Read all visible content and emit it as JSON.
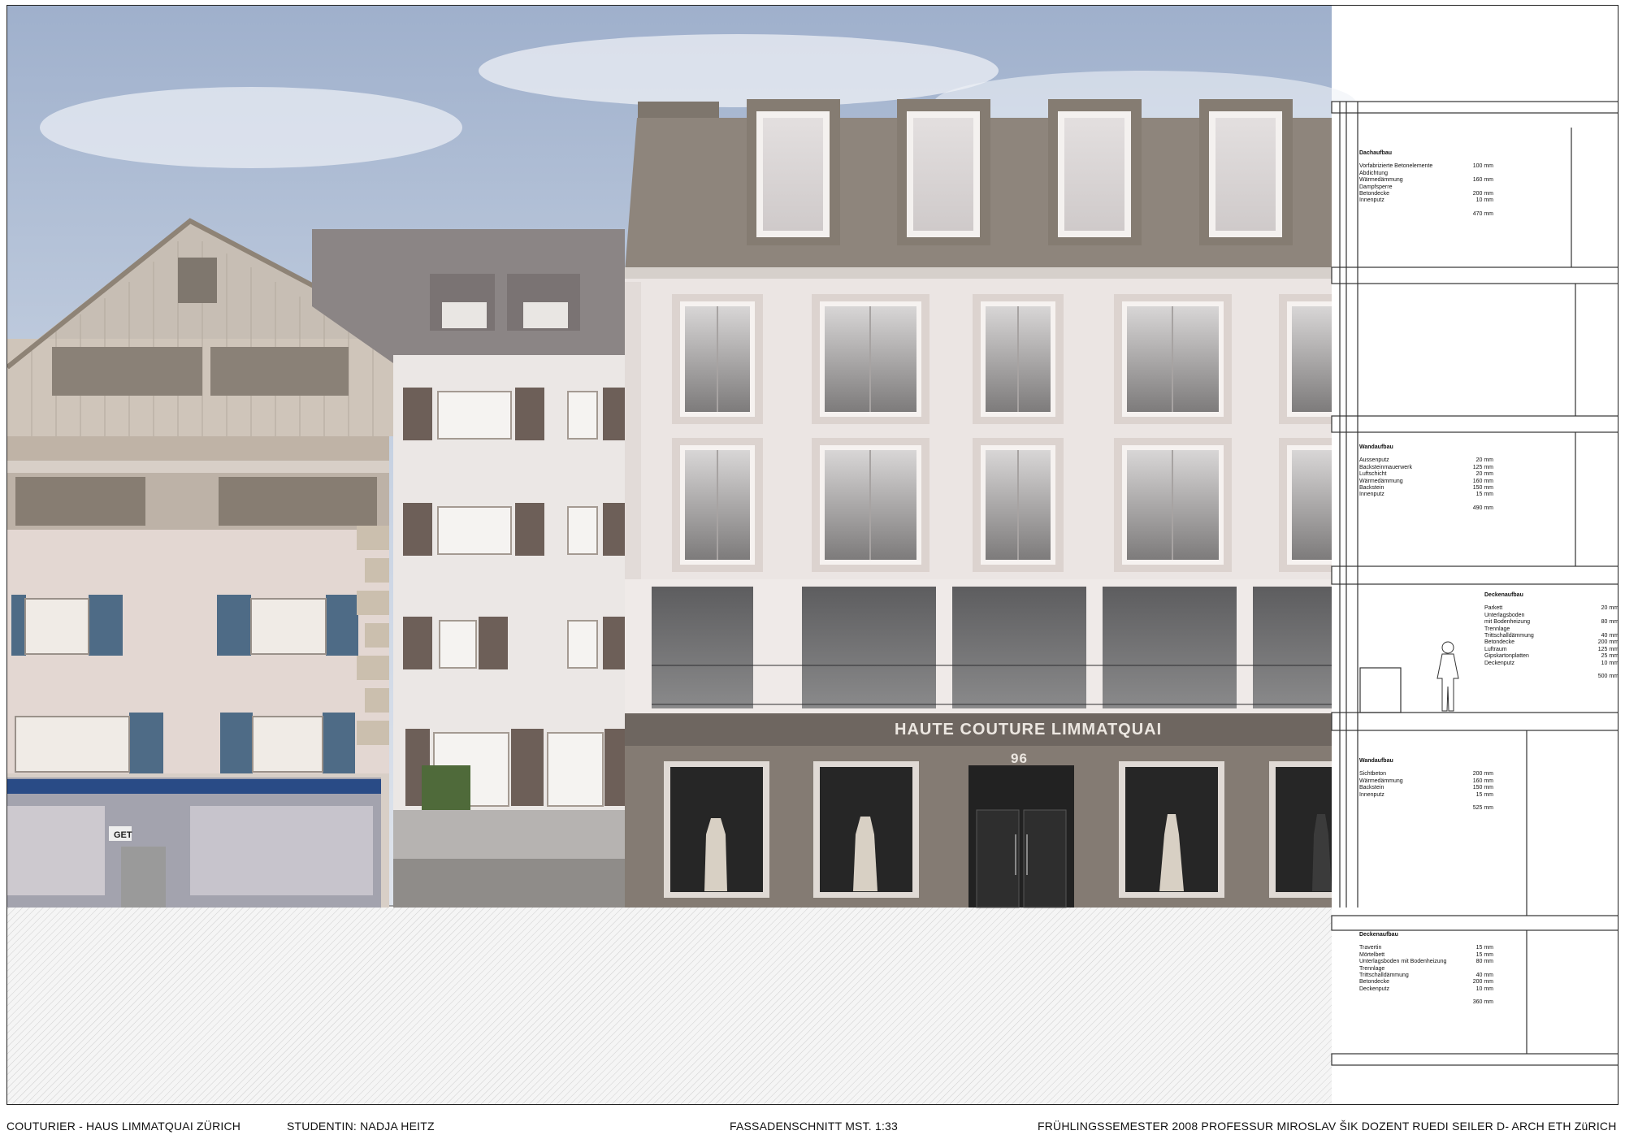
{
  "facade": {
    "sign_text": "HAUTE COUTURE LIMMATQUAI",
    "house_number": "96",
    "neighbor_shop_sign": "GET"
  },
  "footer": {
    "project": "COUTURIER - HAUS LIMMATQUAI  ZÜRICH",
    "student": "STUDENTIN: NADJA HEITZ",
    "drawing": "FASSADENSCHNITT MST. 1:33",
    "semester": "FRÜHLINGSSEMESTER 2008  PROFESSUR MIROSLAV ŠIK  DOZENT RUEDI SEILER  D- ARCH  ETH ZüRICH"
  },
  "section_specs": [
    {
      "heading": "Dachaufbau",
      "rows": [
        {
          "material": "Vorfabrizierte Betonelemente",
          "value": "100 mm"
        },
        {
          "material": "Abdichtung",
          "value": ""
        },
        {
          "material": "Wärmedämmung",
          "value": "160 mm"
        },
        {
          "material": "Dampfsperre",
          "value": ""
        },
        {
          "material": "Betondecke",
          "value": "200 mm"
        },
        {
          "material": "Innenputz",
          "value": "10 mm"
        }
      ],
      "total": "470 mm"
    },
    {
      "heading": "Wandaufbau",
      "rows": [
        {
          "material": "Aussenputz",
          "value": "20 mm"
        },
        {
          "material": "Backsteinmauerwerk",
          "value": "125 mm"
        },
        {
          "material": "Luftschicht",
          "value": "20 mm"
        },
        {
          "material": "Wärmedämmung",
          "value": "160 mm"
        },
        {
          "material": "Backstein",
          "value": "150 mm"
        },
        {
          "material": "Innenputz",
          "value": "15 mm"
        }
      ],
      "total": "490 mm"
    },
    {
      "heading": "Deckenaufbau",
      "rows": [
        {
          "material": "Parkett",
          "value": "20 mm"
        },
        {
          "material": "Unterlagsboden",
          "value": ""
        },
        {
          "material": "mit Bodenheizung",
          "value": "80 mm"
        },
        {
          "material": "Trennlage",
          "value": ""
        },
        {
          "material": "Trittschalldämmung",
          "value": "40 mm"
        },
        {
          "material": "Betondecke",
          "value": "200 mm"
        },
        {
          "material": "Luftraum",
          "value": "125 mm"
        },
        {
          "material": "Gipskartonplatten",
          "value": "25 mm"
        },
        {
          "material": "Deckenputz",
          "value": "10 mm"
        }
      ],
      "total": "500 mm"
    },
    {
      "heading": "Wandaufbau",
      "rows": [
        {
          "material": "Sichtbeton",
          "value": "200 mm"
        },
        {
          "material": "Wärmedämmung",
          "value": "160 mm"
        },
        {
          "material": "Backstein",
          "value": "150 mm"
        },
        {
          "material": "Innenputz",
          "value": "15 mm"
        }
      ],
      "total": "525 mm"
    },
    {
      "heading": "Deckenaufbau",
      "rows": [
        {
          "material": "Travertin",
          "value": "15 mm"
        },
        {
          "material": "Mörtelbett",
          "value": "15 mm"
        },
        {
          "material": "Unterlagsboden mit Bodenheizung",
          "value": "80 mm"
        },
        {
          "material": "Trennlage",
          "value": ""
        },
        {
          "material": "Trittschalldämmung",
          "value": "40 mm"
        },
        {
          "material": "Betondecke",
          "value": "200 mm"
        },
        {
          "material": "Deckenputz",
          "value": "10 mm"
        }
      ],
      "total": "360 mm"
    }
  ]
}
